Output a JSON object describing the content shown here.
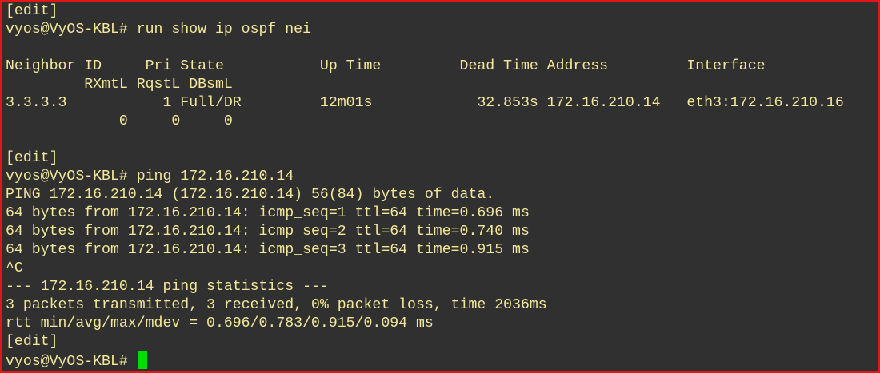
{
  "terminal": {
    "lines": [
      "[edit]",
      "vyos@VyOS-KBL# run show ip ospf nei",
      "",
      "Neighbor ID     Pri State           Up Time         Dead Time Address         Interface",
      "         RXmtL RqstL DBsmL",
      "3.3.3.3           1 Full/DR         12m01s            32.853s 172.16.210.14   eth3:172.16.210.16",
      "             0     0     0",
      "",
      "[edit]",
      "vyos@VyOS-KBL# ping 172.16.210.14",
      "PING 172.16.210.14 (172.16.210.14) 56(84) bytes of data.",
      "64 bytes from 172.16.210.14: icmp_seq=1 ttl=64 time=0.696 ms",
      "64 bytes from 172.16.210.14: icmp_seq=2 ttl=64 time=0.740 ms",
      "64 bytes from 172.16.210.14: icmp_seq=3 ttl=64 time=0.915 ms",
      "^C",
      "--- 172.16.210.14 ping statistics ---",
      "3 packets transmitted, 3 received, 0% packet loss, time 2036ms",
      "rtt min/avg/max/mdev = 0.696/0.783/0.915/0.094 ms",
      "[edit]"
    ],
    "prompt": "vyos@VyOS-KBL# ",
    "text_color": "#f2e79a",
    "background_color": "#303030",
    "border_color": "#e01818",
    "cursor_color": "#00e000"
  }
}
